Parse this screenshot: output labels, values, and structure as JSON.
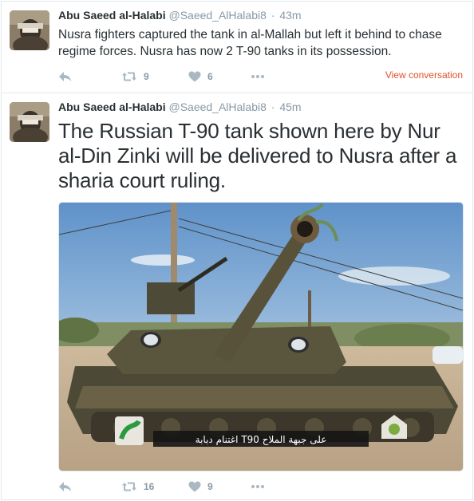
{
  "tweets": [
    {
      "name": "Abu Saeed al-Halabi",
      "handle": "@Saeed_AlHalabi8",
      "separator": "·",
      "time": "43m",
      "text": "Nusra fighters captured the tank in al-Mallah but left it behind to chase regime forces. Nusra has now 2 T-90 tanks in its possession.",
      "retweets": "9",
      "likes": "6",
      "view_conversation": "View conversation"
    },
    {
      "name": "Abu Saeed al-Halabi",
      "handle": "@Saeed_AlHalabi8",
      "separator": "·",
      "time": "45m",
      "text": "The Russian T-90 tank shown here by Nur al-Din Zinki will be delivered to Nusra after a sharia court ruling.",
      "retweets": "16",
      "likes": "9",
      "image_caption": "اغتنام دبابة T90 على جبهة الملاح"
    }
  ],
  "icons": {
    "reply": "reply-icon",
    "retweet": "retweet-icon",
    "like": "heart-icon",
    "more": "more-icon"
  },
  "colors": {
    "name": "#292f33",
    "muted": "#8899a6",
    "icon": "#aab8c2",
    "view_conversation": "#e0502e",
    "border": "#e1e8ed"
  }
}
